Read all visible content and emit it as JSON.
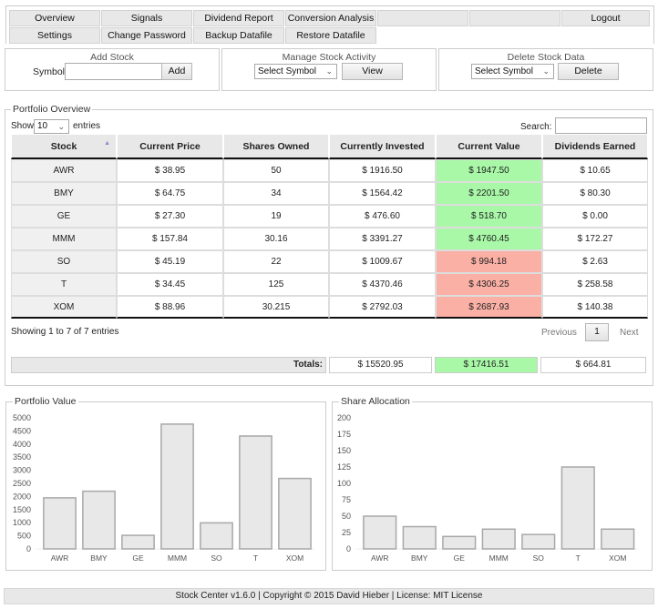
{
  "nav": {
    "row1": [
      "Overview",
      "Signals",
      "Dividend Report",
      "Conversion Analysis",
      "",
      "",
      "Logout"
    ],
    "row2": [
      "Settings",
      "Change Password",
      "Backup Datafile",
      "Restore Datafile"
    ]
  },
  "add_stock": {
    "title": "Add Stock",
    "symbol_label": "Symbol",
    "symbol_value": "",
    "add_label": "Add"
  },
  "manage": {
    "title": "Manage Stock Activity",
    "select_value": "Select Symbol",
    "view_label": "View"
  },
  "delete": {
    "title": "Delete Stock Data",
    "select_value": "Select Symbol",
    "delete_label": "Delete"
  },
  "portfolio": {
    "legend": "Portfolio Overview",
    "show_label": "Show",
    "entries_value": "10",
    "entries_label": "entries",
    "search_label": "Search:",
    "search_value": "",
    "columns": [
      "Stock",
      "Current Price",
      "Shares Owned",
      "Currently Invested",
      "Current Value",
      "Dividends Earned"
    ],
    "rows": [
      {
        "stock": "AWR",
        "price": "$ 38.95",
        "shares": "50",
        "invested": "$ 1916.50",
        "value": "$ 1947.50",
        "status": "pos",
        "dividends": "$ 10.65"
      },
      {
        "stock": "BMY",
        "price": "$ 64.75",
        "shares": "34",
        "invested": "$ 1564.42",
        "value": "$ 2201.50",
        "status": "pos",
        "dividends": "$ 80.30"
      },
      {
        "stock": "GE",
        "price": "$ 27.30",
        "shares": "19",
        "invested": "$ 476.60",
        "value": "$ 518.70",
        "status": "pos",
        "dividends": "$ 0.00"
      },
      {
        "stock": "MMM",
        "price": "$ 157.84",
        "shares": "30.16",
        "invested": "$ 3391.27",
        "value": "$ 4760.45",
        "status": "pos",
        "dividends": "$ 172.27"
      },
      {
        "stock": "SO",
        "price": "$ 45.19",
        "shares": "22",
        "invested": "$ 1009.67",
        "value": "$ 994.18",
        "status": "neg",
        "dividends": "$ 2.63"
      },
      {
        "stock": "T",
        "price": "$ 34.45",
        "shares": "125",
        "invested": "$ 4370.46",
        "value": "$ 4306.25",
        "status": "neg",
        "dividends": "$ 258.58"
      },
      {
        "stock": "XOM",
        "price": "$ 88.96",
        "shares": "30.215",
        "invested": "$ 2792.03",
        "value": "$ 2687.93",
        "status": "neg",
        "dividends": "$ 140.38"
      }
    ],
    "info": "Showing 1 to 7 of 7 entries",
    "previous_label": "Previous",
    "page": "1",
    "next_label": "Next",
    "totals_label": "Totals:",
    "totals": {
      "invested": "$ 15520.95",
      "value": "$ 17416.51",
      "dividends": "$ 664.81"
    }
  },
  "colors": {
    "positive": "#a8f8a8",
    "negative": "#fbb0a6"
  },
  "chart_data": [
    {
      "type": "bar",
      "title": "Portfolio Value",
      "categories": [
        "AWR",
        "BMY",
        "GE",
        "MMM",
        "SO",
        "T",
        "XOM"
      ],
      "values": [
        1947.5,
        2201.5,
        518.7,
        4760.45,
        994.18,
        4306.25,
        2687.93
      ],
      "yticks": [
        0,
        500,
        1000,
        1500,
        2000,
        2500,
        3000,
        3500,
        4000,
        4500,
        5000
      ],
      "ylim": [
        0,
        5000
      ],
      "xlabel": "",
      "ylabel": "",
      "grid": false
    },
    {
      "type": "bar",
      "title": "Share Allocation",
      "categories": [
        "AWR",
        "BMY",
        "GE",
        "MMM",
        "SO",
        "T",
        "XOM"
      ],
      "values": [
        50,
        34,
        19,
        30.16,
        22,
        125,
        30.215
      ],
      "yticks": [
        0,
        25,
        50,
        75,
        100,
        125,
        150,
        175,
        200
      ],
      "ylim": [
        0,
        200
      ],
      "xlabel": "",
      "ylabel": "",
      "grid": false
    }
  ],
  "footer": {
    "text": "Stock Center v1.6.0   |   Copyright © 2015 David Hieber   |   License: MIT License"
  }
}
